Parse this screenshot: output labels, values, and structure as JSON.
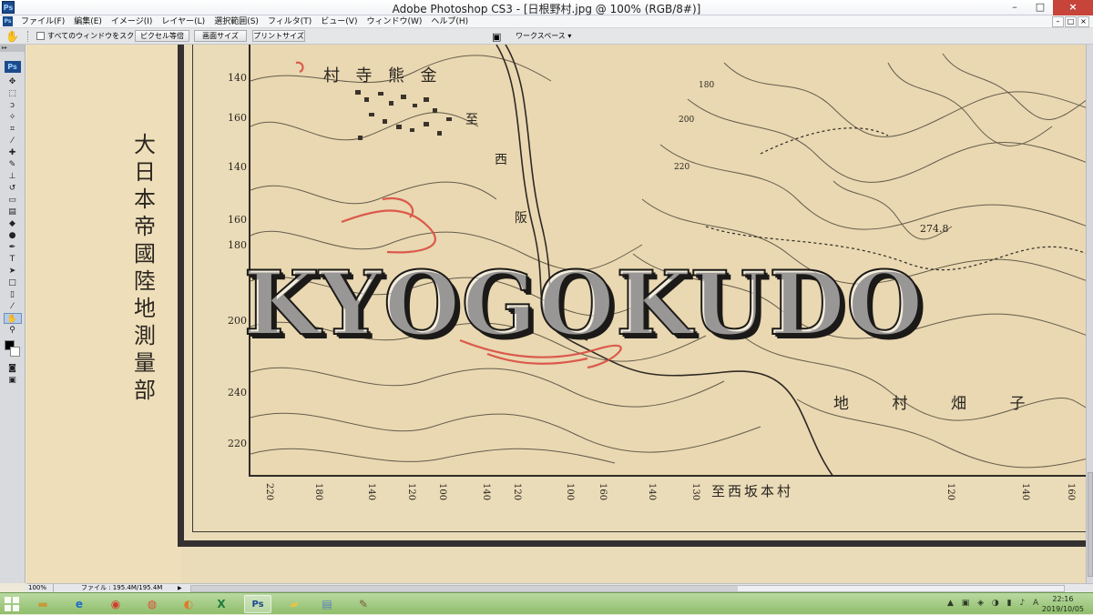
{
  "window": {
    "app_icon": "Ps",
    "title": "Adobe Photoshop CS3 - [日根野村.jpg @ 100% (RGB/8#)]",
    "buttons": [
      "–",
      "□",
      "×"
    ]
  },
  "menu": {
    "icon": "Ps",
    "items": [
      "ファイル(F)",
      "編集(E)",
      "イメージ(I)",
      "レイヤー(L)",
      "選択範囲(S)",
      "フィルタ(T)",
      "ビュー(V)",
      "ウィンドウ(W)",
      "ヘルプ(H)"
    ],
    "doc_buttons": [
      "–",
      "□",
      "×"
    ]
  },
  "options": {
    "scroll_all_label": "すべてのウィンドウをスクロール",
    "btn_actual": "ピクセル等倍",
    "btn_fit": "画面サイズ",
    "btn_print": "プリントサイズ",
    "workspace": "ワークスペース ▾"
  },
  "toolbox": {
    "logo": "Ps",
    "tools": [
      "move-tool",
      "marquee-tool",
      "lasso-tool",
      "magic-wand-tool",
      "crop-tool",
      "slice-tool",
      "healing-brush-tool",
      "brush-tool",
      "clone-stamp-tool",
      "history-brush-tool",
      "eraser-tool",
      "gradient-tool",
      "blur-tool",
      "dodge-tool",
      "pen-tool",
      "type-tool",
      "path-selection-tool",
      "shape-tool",
      "notes-tool",
      "eyedropper-tool",
      "hand-tool",
      "zoom-tool"
    ],
    "active_tool": "hand-tool",
    "foreground_color": "#000000",
    "background_color": "#ffffff"
  },
  "map": {
    "side_title": [
      "大",
      "日",
      "本",
      "帝",
      "國",
      "陸",
      "地",
      "測",
      "量",
      "部"
    ],
    "village_name": [
      "村",
      "寺",
      "熊",
      "金"
    ],
    "road_label_top": "至",
    "road_label_west": "西",
    "road_label_right": "阪",
    "spot_height": "274.8",
    "land_label": [
      "地",
      "村",
      "畑",
      "子"
    ],
    "contour_numbers": [
      "180",
      "200",
      "220"
    ],
    "elevation_left": [
      "140",
      "160",
      "140",
      "160",
      "180",
      "200",
      "240",
      "220"
    ],
    "bottom_numbers": [
      "220",
      "180",
      "140",
      "120",
      "100",
      "140",
      "120",
      "100",
      "160",
      "140",
      "130",
      "120",
      "140",
      "160"
    ],
    "bottom_caption": "至西坂本村",
    "accent_red": "#d9443a",
    "paper_color": "#eadcb8",
    "ink_color": "#2a2520"
  },
  "watermark": "KYOGOKUDO",
  "status": {
    "zoom": "100%",
    "file_info": "ファイル : 195.4M/195.4M"
  },
  "taskbar": {
    "apps": [
      "file-explorer-icon",
      "internet-explorer-icon",
      "security-app-icon",
      "chrome-icon",
      "firefox-icon",
      "excel-icon",
      "photoshop-icon",
      "folder-icon",
      "document-icon",
      "paint-icon"
    ],
    "excel_glyph": "X",
    "photoshop_glyph": "Ps",
    "clock_time": "22:16",
    "clock_date": "2019/10/05"
  }
}
